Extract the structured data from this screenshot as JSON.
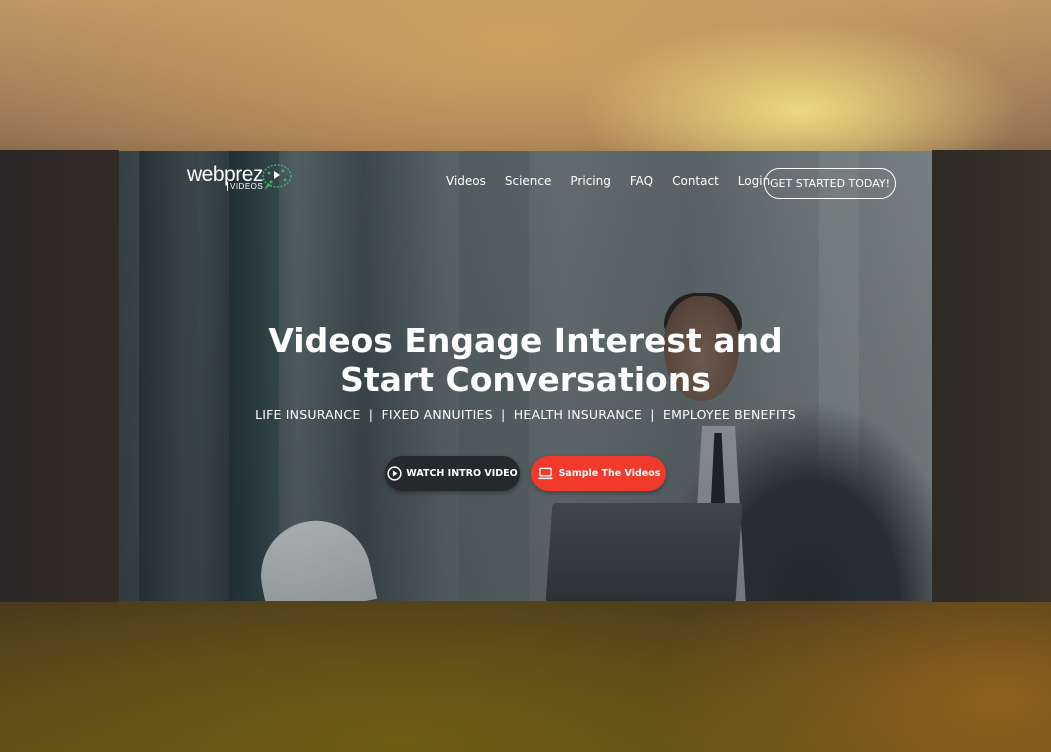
{
  "brand": {
    "logo_text": "webprez",
    "logo_sub": "VIDEOS",
    "accent_green": "#3fae6a",
    "accent_red": "#f1392c"
  },
  "nav": {
    "items": [
      {
        "label": "Videos"
      },
      {
        "label": "Science"
      },
      {
        "label": "Pricing"
      },
      {
        "label": "FAQ"
      },
      {
        "label": "Contact"
      },
      {
        "label": "Login"
      }
    ],
    "cta_label": "GET STARTED TODAY!"
  },
  "hero": {
    "headline_line1": "Videos Engage Interest and",
    "headline_line2": "Start Conversations",
    "subline": "LIFE INSURANCE  |  FIXED ANNUITIES  |  HEALTH INSURANCE  |  EMPLOYEE BENEFITS",
    "watch_button": {
      "label": "WATCH INTRO VIDEO",
      "icon": "play-circle-icon"
    },
    "sample_button": {
      "label": "Sample The Videos",
      "icon": "laptop-icon"
    }
  }
}
